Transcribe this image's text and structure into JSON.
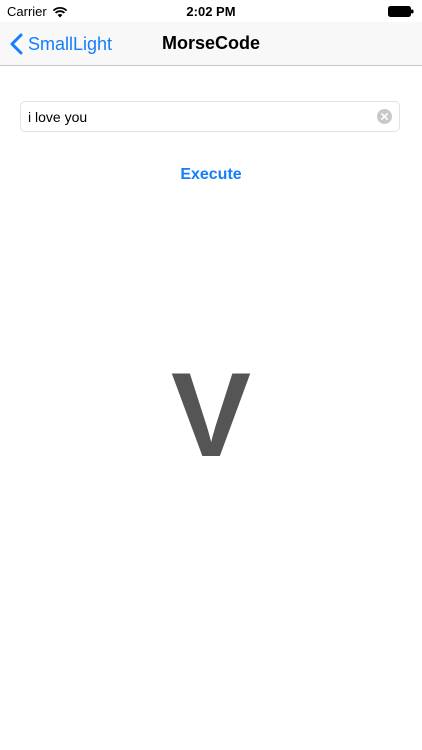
{
  "status_bar": {
    "carrier": "Carrier",
    "time": "2:02 PM",
    "wifi_icon": "wifi-icon",
    "battery_icon": "battery-full-icon"
  },
  "nav_bar": {
    "back_label": "SmallLight",
    "back_icon": "chevron-left-icon",
    "title": "MorseCode"
  },
  "input": {
    "value": "i love you",
    "placeholder": "",
    "clear_icon": "clear-circle-icon"
  },
  "execute_button": {
    "label": "Execute"
  },
  "display": {
    "letter": "V"
  },
  "colors": {
    "accent": "#147efb",
    "letter": "#555555",
    "nav_background": "#f8f8f8"
  }
}
